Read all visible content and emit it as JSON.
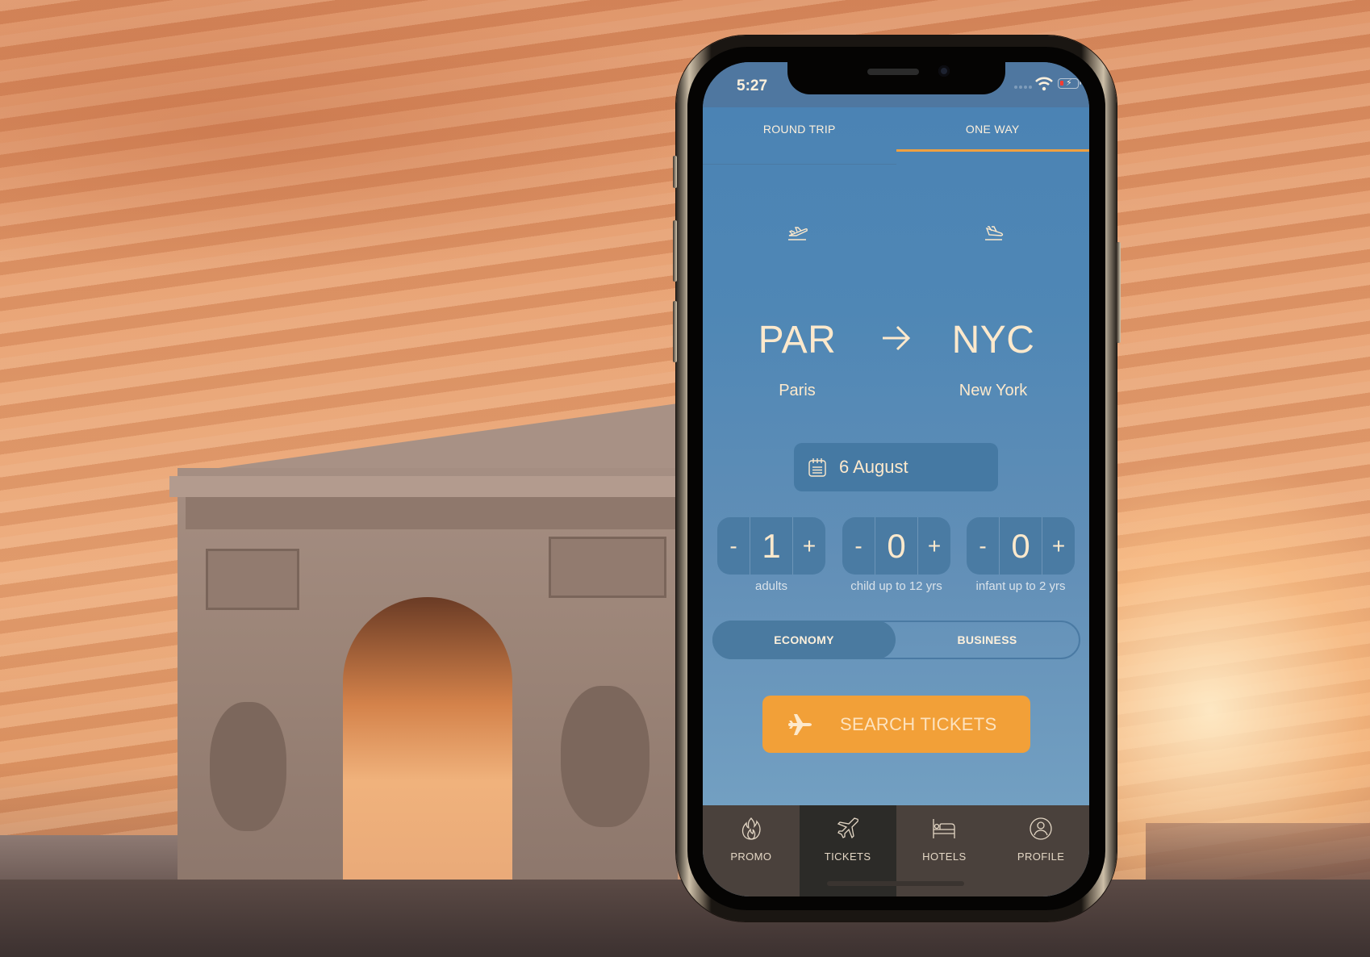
{
  "status_bar": {
    "time": "5:27",
    "battery_state": "low, charging",
    "icons": [
      "signal-dots-icon",
      "wifi-icon",
      "battery-charging-icon"
    ]
  },
  "trip_tabs": [
    {
      "label": "ROUND TRIP",
      "active": false
    },
    {
      "label": "ONE WAY",
      "active": true
    }
  ],
  "route": {
    "from": {
      "code": "PAR",
      "city": "Paris",
      "icon": "plane-takeoff-icon"
    },
    "to": {
      "code": "NYC",
      "city": "New York",
      "icon": "plane-landing-icon"
    },
    "arrow_icon": "arrow-right-icon"
  },
  "date": {
    "label": "6 August",
    "icon": "calendar-icon"
  },
  "passengers": [
    {
      "minus": "-",
      "value": "1",
      "plus": "+",
      "label": "adults"
    },
    {
      "minus": "-",
      "value": "0",
      "plus": "+",
      "label": "child up to 12 yrs"
    },
    {
      "minus": "-",
      "value": "0",
      "plus": "+",
      "label": "infant up to 2 yrs"
    }
  ],
  "travel_class": [
    {
      "label": "ECONOMY",
      "active": true
    },
    {
      "label": "BUSINESS",
      "active": false
    }
  ],
  "search_button": {
    "label": "SEARCH TICKETS",
    "icon": "airplane-icon"
  },
  "tab_bar": [
    {
      "label": "PROMO",
      "icon": "flame-icon",
      "active": false
    },
    {
      "label": "TICKETS",
      "icon": "airplane-icon",
      "active": true
    },
    {
      "label": "HOTELS",
      "icon": "bed-icon",
      "active": false
    },
    {
      "label": "PROFILE",
      "icon": "user-circle-icon",
      "active": false
    }
  ],
  "colors": {
    "accent_orange": "#f2a038",
    "app_blue": "#4f87b5",
    "text_cream": "#fde9cc",
    "tabbar_bg": "#4a413c",
    "tabbar_active_bg": "#2c2b28"
  }
}
